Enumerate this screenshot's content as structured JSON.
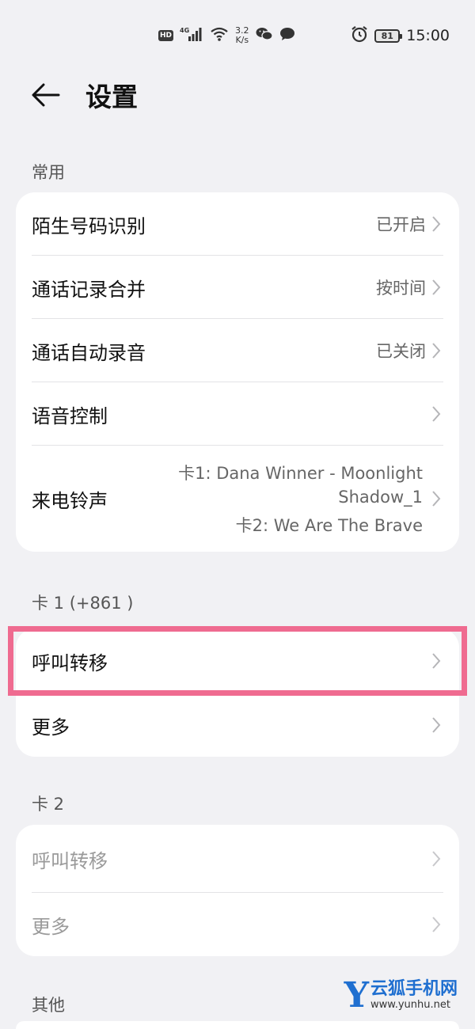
{
  "status_bar": {
    "hd": "HD",
    "network": "4G",
    "speed_value": "3.2",
    "speed_unit": "K/s",
    "battery": "81",
    "time": "15:00"
  },
  "header": {
    "title": "设置"
  },
  "sections": {
    "common": {
      "label": "常用",
      "rows": {
        "caller_id": {
          "label": "陌生号码识别",
          "value": "已开启"
        },
        "merge_logs": {
          "label": "通话记录合并",
          "value": "按时间"
        },
        "auto_record": {
          "label": "通话自动录音",
          "value": "已关闭"
        },
        "voice_control": {
          "label": "语音控制"
        },
        "ringtone": {
          "label": "来电铃声",
          "value_line1": "卡1: Dana Winner - Moonlight",
          "value_line2": "Shadow_1",
          "value_line3": "卡2: We Are The Brave"
        }
      }
    },
    "sim1": {
      "label": "卡 1 (+861                )",
      "rows": {
        "forwarding": {
          "label": "呼叫转移"
        },
        "more": {
          "label": "更多"
        }
      }
    },
    "sim2": {
      "label": "卡 2",
      "rows": {
        "forwarding": {
          "label": "呼叫转移"
        },
        "more": {
          "label": "更多"
        }
      }
    },
    "other": {
      "label": "其他"
    }
  },
  "watermark": {
    "logo_letter": "Y",
    "name": "云狐手机网",
    "url": "www.yunhu.net"
  },
  "colors": {
    "highlight": "#ef6b90",
    "watermark": "#1f6fd0"
  }
}
